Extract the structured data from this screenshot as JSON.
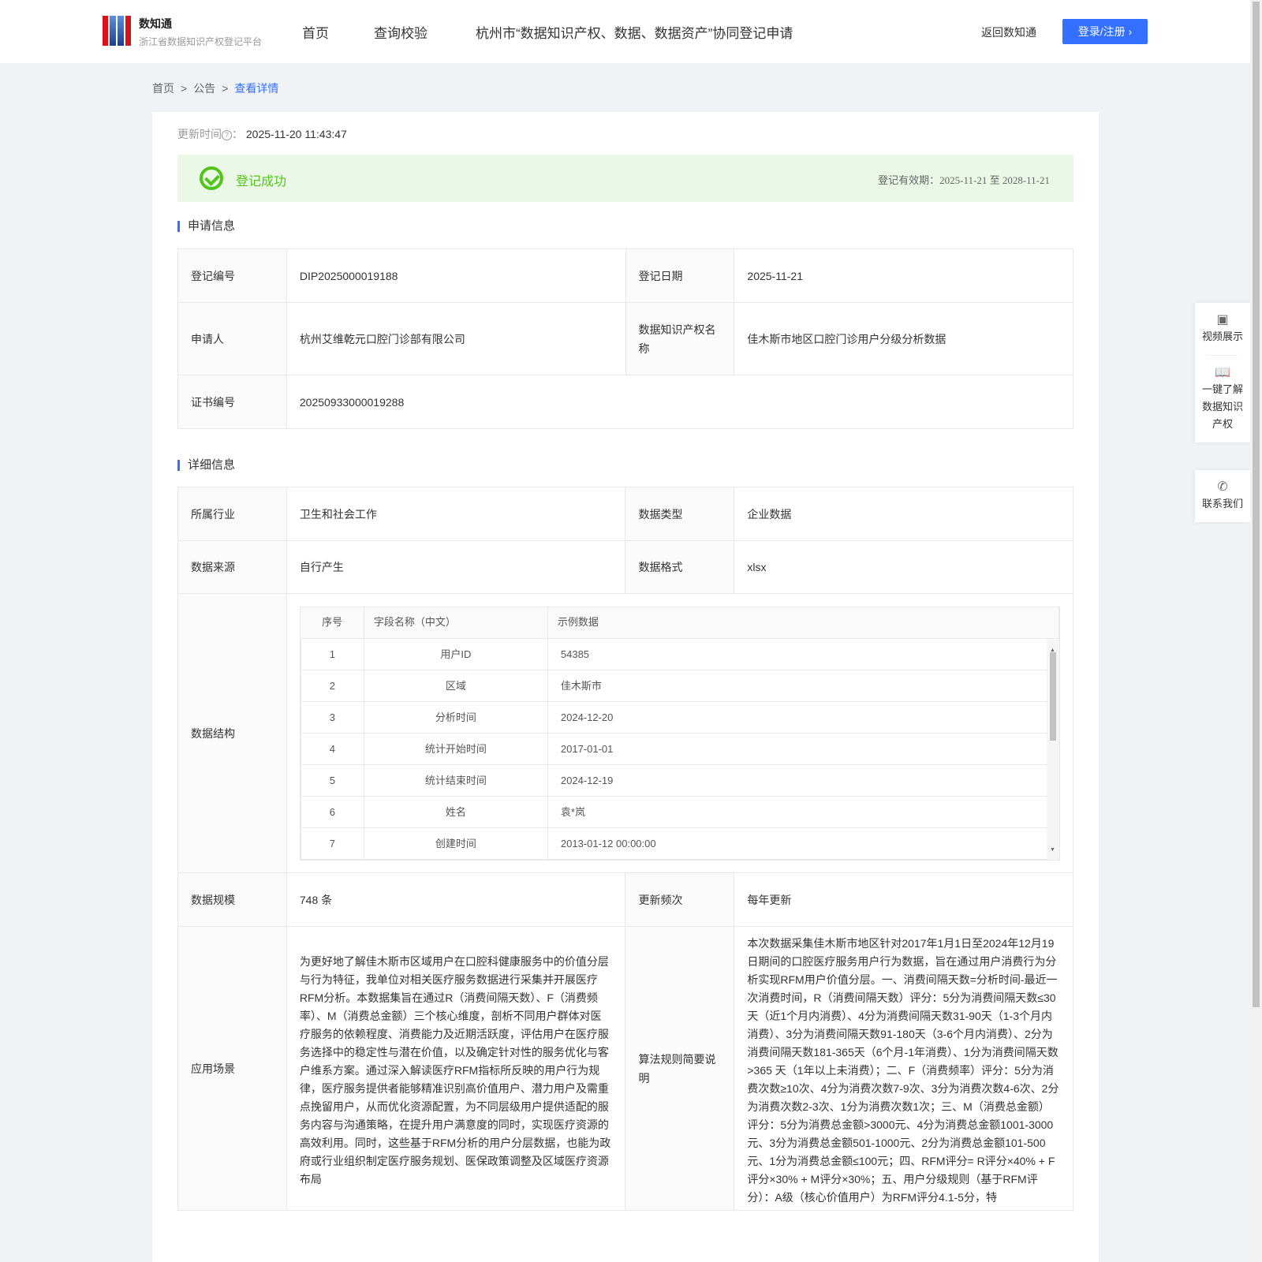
{
  "header": {
    "brand_title": "数知通",
    "brand_subtitle": "浙江省数据知识产权登记平台",
    "nav": [
      "首页",
      "查询校验",
      "杭州市“数据知识产权、数据、数据资产”协同登记申请"
    ],
    "back_link": "返回数知通",
    "login_button": "登录/注册 ›"
  },
  "breadcrumb": [
    "首页",
    "公告",
    "查看详情"
  ],
  "update": {
    "label": "更新时间",
    "sep": "：",
    "value": "2025-11-20 11:43:47"
  },
  "status": {
    "text": "登记成功",
    "validity": "登记有效期：2025-11-21 至 2028-11-21",
    "color": "#52c41a"
  },
  "section1": {
    "title": "申请信息",
    "reg_no_label": "登记编号",
    "reg_no": "DIP2025000019188",
    "reg_date_label": "登记日期",
    "reg_date": "2025-11-21",
    "applicant_label": "申请人",
    "applicant": "杭州艾维乾元口腔门诊部有限公司",
    "ip_name_label": "数据知识产权名称",
    "ip_name": "佳木斯市地区口腔门诊用户分级分析数据",
    "cert_label": "证书编号",
    "cert": "20250933000019288"
  },
  "section2": {
    "title": "详细信息",
    "industry_label": "所属行业",
    "industry": "卫生和社会工作",
    "type_label": "数据类型",
    "type": "企业数据",
    "source_label": "数据来源",
    "source": "自行产生",
    "format_label": "数据格式",
    "format": "xlsx",
    "structure_label": "数据结构",
    "structure_headers": [
      "序号",
      "字段名称（中文）",
      "示例数据"
    ],
    "structure_rows": [
      [
        "1",
        "用户ID",
        "54385"
      ],
      [
        "2",
        "区域",
        "佳木斯市"
      ],
      [
        "3",
        "分析时间",
        "2024-12-20"
      ],
      [
        "4",
        "统计开始时间",
        "2017-01-01"
      ],
      [
        "5",
        "统计结束时间",
        "2024-12-19"
      ],
      [
        "6",
        "姓名",
        "袁*岚"
      ],
      [
        "7",
        "创建时间",
        "2013-01-12 00:00:00"
      ]
    ],
    "scale_label": "数据规模",
    "scale": "748 条",
    "freq_label": "更新频次",
    "freq": "每年更新",
    "scene_label": "应用场景",
    "scene": "为更好地了解佳木斯市区域用户在口腔科健康服务中的价值分层与行为特征，我单位对相关医疗服务数据进行采集并开展医疗RFM分析。本数据集旨在通过R（消费间隔天数）、F（消费频率）、M（消费总金额）三个核心维度，剖析不同用户群体对医疗服务的依赖程度、消费能力及近期活跃度，评估用户在医疗服务选择中的稳定性与潜在价值，以及确定针对性的服务优化与客户维系方案。通过深入解读医疗RFM指标所反映的用户行为规律，医疗服务提供者能够精准识别高价值用户、潜力用户及需重点挽留用户，从而优化资源配置，为不同层级用户提供适配的服务内容与沟通策略，在提升用户满意度的同时，实现医疗资源的高效利用。同时，这些基于RFM分析的用户分层数据，也能为政府或行业组织制定医疗服务规划、医保政策调整及区域医疗资源布局",
    "algo_label": "算法规则简要说明",
    "algo": "本次数据采集佳木斯市地区针对2017年1月1日至2024年12月19日期间的口腔医疗服务用户行为数据，旨在通过用户消费行为分析实现RFM用户价值分层。一、消费间隔天数=分析时间-最近一次消费时间，R（消费间隔天数）评分：5分为消费间隔天数≤30天（近1个月内消费）、4分为消费间隔天数31-90天（1-3个月内消费）、3分为消费间隔天数91-180天（3-6个月内消费）、2分为消费间隔天数181-365天（6个月-1年消费）、1分为消费间隔天数>365 天（1年以上未消费）；二、F（消费频率）评分：5分为消费次数≥10次、4分为消费次数7-9次、3分为消费次数4-6次、2分为消费次数2-3次、1分为消费次数1次；三、M（消费总金额）评分：5分为消费总金额>3000元、4分为消费总金额1001-3000元、3分为消费总金额501-1000元、2分为消费总金额101-500元、1分为消费总金额≤100元；四、RFM评分= R评分×40% + F 评分×30% + M评分×30%；五、用户分级规则（基于RFM评分）：A级（核心价值用户）为RFM评分4.1-5分，特"
  },
  "float_panel": {
    "video": "视频展示",
    "learn": "一键了解数据知识产权",
    "contact": "联系我们"
  }
}
